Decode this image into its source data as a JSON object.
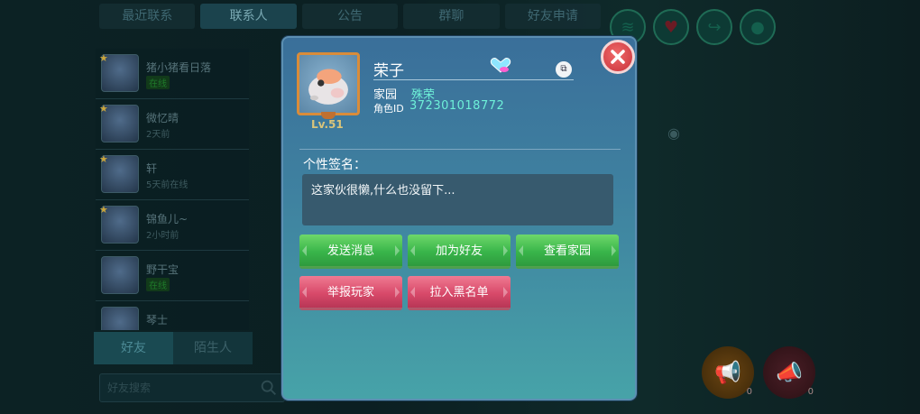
{
  "background": {
    "tabs": [
      "最近联系",
      "联系人",
      "公告",
      "群聊",
      "好友申请"
    ],
    "active_tab_index": 1,
    "friends": [
      {
        "name": "猪小猪看日落",
        "status": "在线",
        "online": true
      },
      {
        "name": "微忆晴",
        "status": "2天前",
        "online": false
      },
      {
        "name": "轩",
        "status": "5天前在线",
        "online": false
      },
      {
        "name": "锦鱼儿~",
        "status": "2小时前",
        "online": false
      },
      {
        "name": "野干宝",
        "status": "在线",
        "online": true
      },
      {
        "name": "琴士",
        "status": "",
        "online": false
      }
    ],
    "bottom_tabs": [
      "好友",
      "陌生人"
    ],
    "search_placeholder": "好友搜索",
    "horn_count_1": "0",
    "horn_count_2": "0"
  },
  "dialog": {
    "player_name": "荣子",
    "level": "Lv.51",
    "home_label": "家园",
    "home_value": "殊荣",
    "id_label": "角色ID",
    "id_value": "372301018772",
    "signature_label": "个性签名：",
    "signature_text": "这家伙很懒,什么也没留下...",
    "buttons": {
      "send_message": "发送消息",
      "add_friend": "加为好友",
      "view_home": "查看家园",
      "report_player": "举报玩家",
      "blacklist": "拉入黑名单"
    }
  },
  "colors": {
    "accent_cyan": "#6ef0d8",
    "green_button": "#39b54a",
    "pink_button": "#d84a6a",
    "close_red": "#c8323a",
    "frame_orange": "#d98c3a"
  }
}
